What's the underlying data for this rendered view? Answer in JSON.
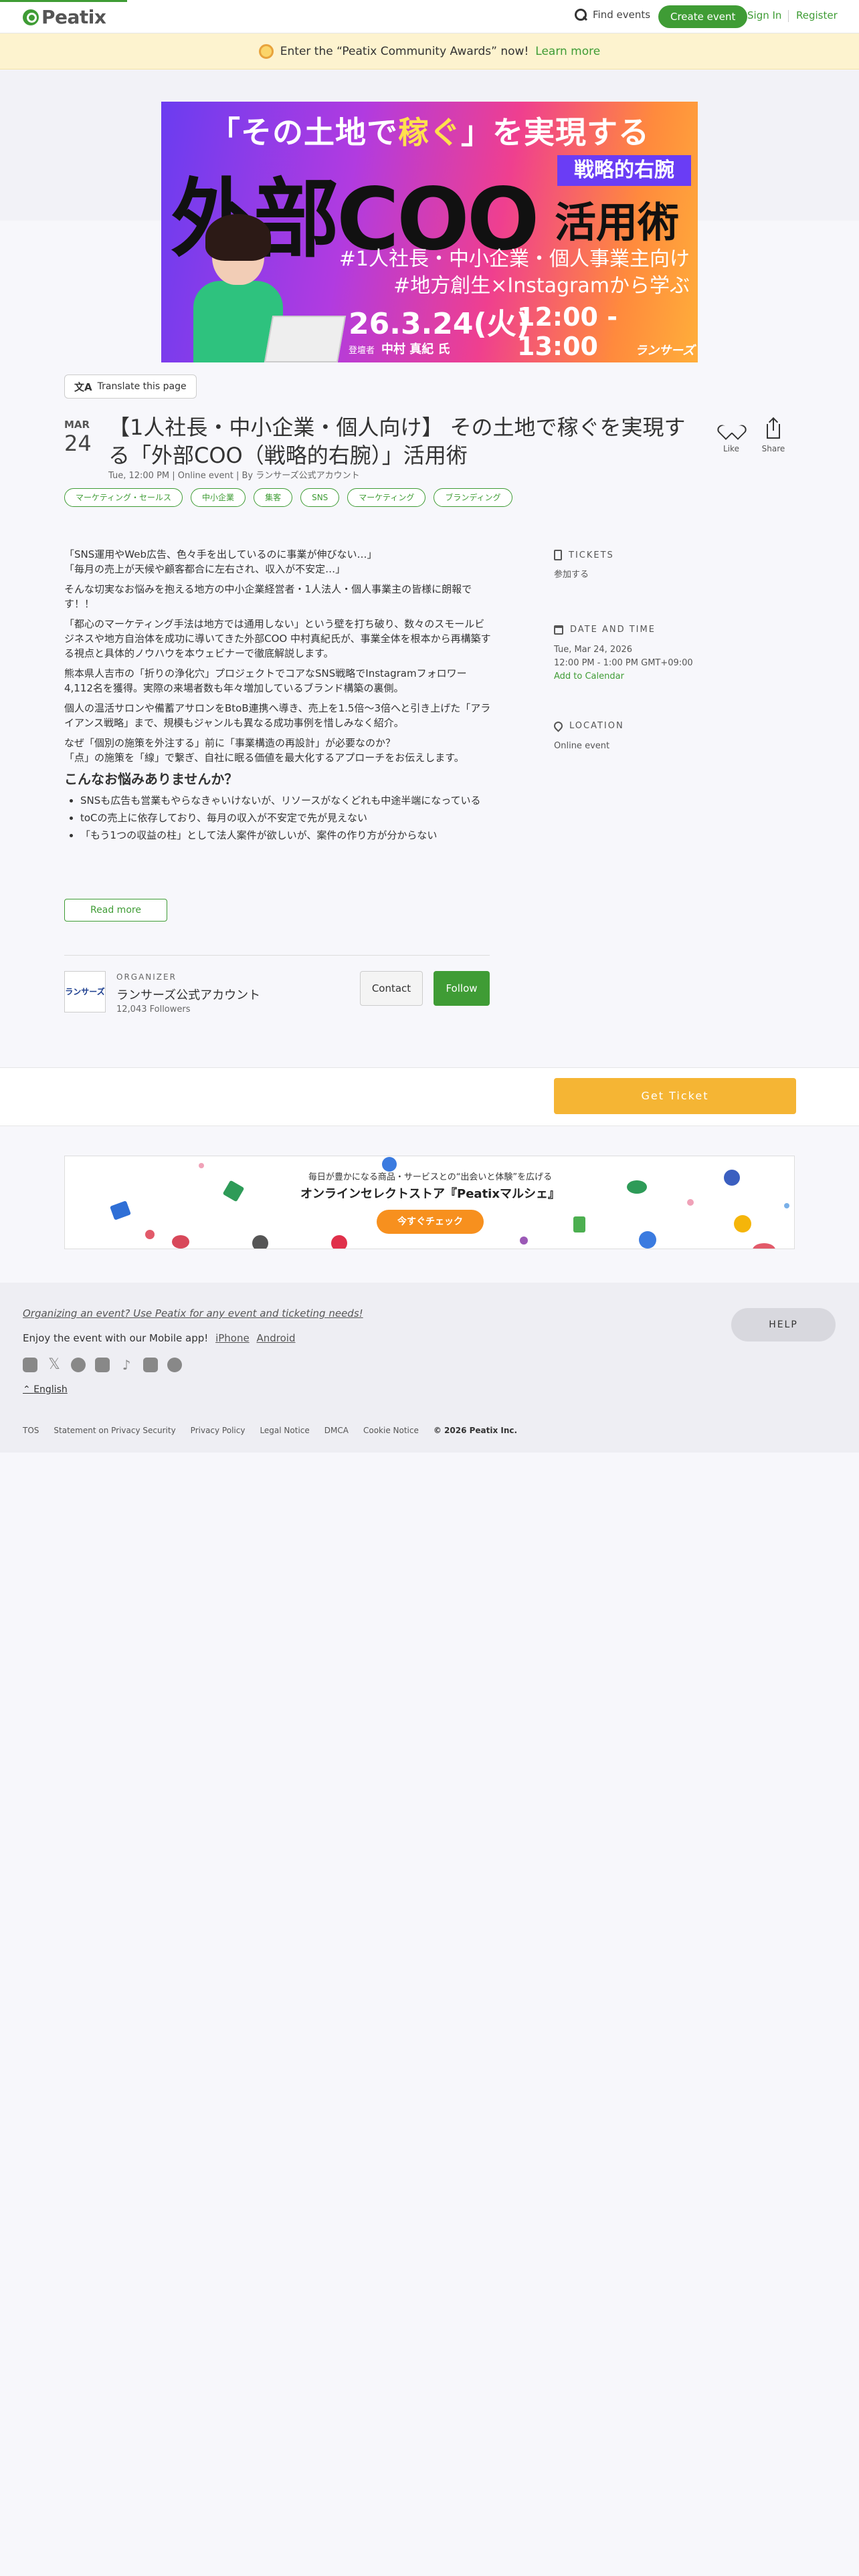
{
  "header": {
    "logo": "Peatix",
    "find_events": "Find events",
    "create_event": "Create event",
    "sign_in": "Sign In",
    "register": "Register"
  },
  "banner": {
    "text": "Enter the “Peatix Community Awards” now!",
    "link": "Learn more"
  },
  "hero": {
    "line1_a": "「その土地で",
    "line1_hl": "稼ぐ",
    "line1_b": "」を実現する",
    "big": "外部COO",
    "tag": "戦略的右腕",
    "katsuyou": "活用術",
    "sub1": "#1人社長・中小企業・個人事業主向け",
    "sub2": "#地方創生×Instagramから学ぶ",
    "date": "26.3.24(火)",
    "time": "12:00 - 13:00",
    "speaker_label": "登壇者",
    "speaker_name": "中村 真紀 氏",
    "brand": "ランサーズ"
  },
  "translate": "Translate this page",
  "event": {
    "month": "MAR",
    "day": "24",
    "title": "【1人社長・中小企業・個人向け】 その土地で稼ぐを実現する「外部COO（戦略的右腕）」活用術",
    "meta": "Tue, 12:00 PM |  Online event |  By ランサーズ公式アカウント",
    "like": "Like",
    "share": "Share",
    "tags": [
      "マーケティング・セールス",
      "中小企業",
      "集客",
      "SNS",
      "マーケティング",
      "ブランディング"
    ]
  },
  "description": {
    "p1a": "「SNS運用やWeb広告、色々手を出しているのに事業が伸びない…」",
    "p1b": "「毎月の売上が天候や顧客都合に左右され、収入が不安定…」",
    "p2": "そんな切実なお悩みを抱える地方の中小企業経営者・1人法人・個人事業主の皆様に朗報です！！",
    "p3": "「都心のマーケティング手法は地方では通用しない」という壁を打ち破り、数々のスモールビジネスや地方自治体を成功に導いてきた外部COO 中村真紀氏が、事業全体を根本から再構築する視点と具体的ノウハウを本ウェビナーで徹底解説します。",
    "p4": "熊本県人吉市の「折りの浄化穴」プロジェクトでコアなSNS戦略でInstagramフォロワー4,112名を獲得。実際の来場者数も年々増加しているブランド構築の裏側。",
    "p5": "個人の温活サロンや備蓄アサロンをBtoB連携へ導き、売上を1.5倍〜3倍へと引き上げた「アライアンス戦略」まで、規模もジャンルも異なる成功事例を惜しみなく紹介。",
    "p6a": "なぜ「個別の施策を外注する」前に「事業構造の再設計」が必要なのか？",
    "p6b": "「点」の施策を「線」で繋ぎ、自社に眠る価値を最大化するアプローチをお伝えします。",
    "heading": "こんなお悩みありませんか？",
    "bullets": [
      "SNSも広告も営業もやらなきゃいけないが、リソースがなくどれも中途半端になっている",
      "toCの売上に依存しており、毎月の収入が不安定で先が見えない",
      "「もう1つの収益の柱」として法人案件が欲しいが、案件の作り方が分からない"
    ],
    "read_more": "Read more"
  },
  "organizer": {
    "label": "ORGANIZER",
    "logo_text": "ランサーズ",
    "name": "ランサーズ公式アカウント",
    "followers": "12,043 Followers",
    "contact": "Contact",
    "follow": "Follow"
  },
  "sidebar": {
    "tickets_h": "TICKETS",
    "tickets_v": "参加する",
    "date_h": "DATE AND TIME",
    "date_v1": "Tue, Mar 24, 2026",
    "date_v2": "12:00 PM - 1:00 PM GMT+09:00",
    "add_cal": "Add to Calendar",
    "loc_h": "LOCATION",
    "loc_v": "Online event"
  },
  "get_ticket": "Get Ticket",
  "ad": {
    "line1": "毎日が豊かになる商品・サービスとの“出会いと体験”を広げる",
    "line2": "オンラインセレクトストア『Peatixマルシェ』",
    "button": "今すぐチェック"
  },
  "footer": {
    "organizing": "Organizing an event? Use Peatix for any event and ticketing needs!",
    "app": "Enjoy the event with our Mobile app!",
    "iphone": "iPhone",
    "android": "Android",
    "language": "English",
    "help": "HELP",
    "links": [
      "TOS",
      "Statement on Privacy Security",
      "Privacy Policy",
      "Legal Notice",
      "DMCA",
      "Cookie Notice"
    ],
    "copyright": "© 2026 Peatix Inc."
  }
}
